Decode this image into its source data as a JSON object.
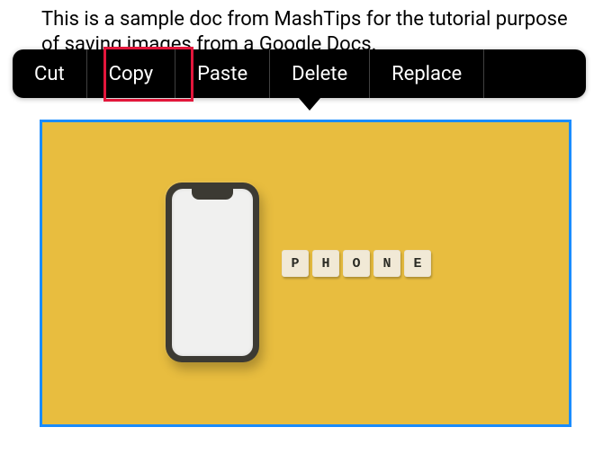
{
  "document": {
    "paragraph": "This is a sample doc from MashTips for the tutorial purpose of saving images from a Google Docs."
  },
  "context_menu": {
    "items": {
      "cut": "Cut",
      "copy": "Copy",
      "paste": "Paste",
      "delete": "Delete",
      "replace": "Replace"
    }
  },
  "image": {
    "tiles": [
      "P",
      "H",
      "O",
      "N",
      "E"
    ]
  }
}
